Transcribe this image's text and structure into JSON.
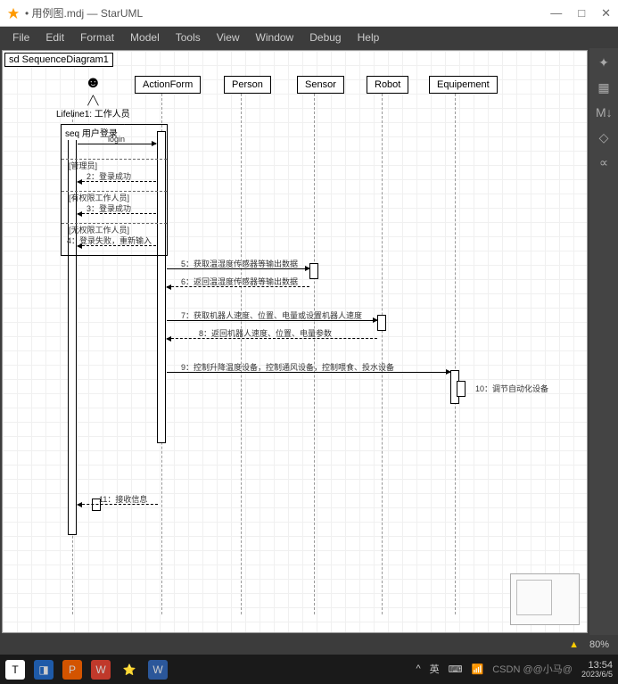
{
  "window": {
    "title": "• 用例图.mdj — StarUML",
    "controls": {
      "min": "—",
      "max": "□",
      "close": "✕"
    }
  },
  "menubar": [
    "File",
    "Edit",
    "Format",
    "Model",
    "Tools",
    "View",
    "Window",
    "Debug",
    "Help"
  ],
  "diagram": {
    "frame_label": "sd  SequenceDiagram1",
    "actor": {
      "name": "Lifeline1: 工作人员"
    },
    "lifelines": [
      "ActionForm",
      "Person",
      "Sensor",
      "Robot",
      "Equipement"
    ],
    "fragment": {
      "label": "seq  用户登录",
      "operands": [
        {
          "guard": "login",
          "msg": ""
        },
        {
          "guard": "[管理员]",
          "msg": "2：登录成功"
        },
        {
          "guard": "[有权限工作人员]",
          "msg": "3：登录成功"
        },
        {
          "guard": "[无权限工作人员]",
          "msg": "4：登录失败，重新输入"
        }
      ]
    },
    "messages": [
      {
        "n": 5,
        "text": "5：获取温湿度传感器等输出数据"
      },
      {
        "n": 6,
        "text": "6：返回温湿度传感器等输出数据"
      },
      {
        "n": 7,
        "text": "7：获取机器人速度、位置、电量或设置机器人速度"
      },
      {
        "n": 8,
        "text": "8：返回机器人速度、位置、电量参数"
      },
      {
        "n": 9,
        "text": "9：控制升降温度设备，控制通风设备，控制喂食、投水设备"
      },
      {
        "n": 10,
        "text": "10：调节自动化设备"
      },
      {
        "n": 11,
        "text": "11：接收信息"
      }
    ]
  },
  "statusbar": {
    "zoom": "80%"
  },
  "taskbar": {
    "clock": "13:54",
    "date": "2023/6/5",
    "lang": "英",
    "watermark": "CSDN @@小马@"
  }
}
